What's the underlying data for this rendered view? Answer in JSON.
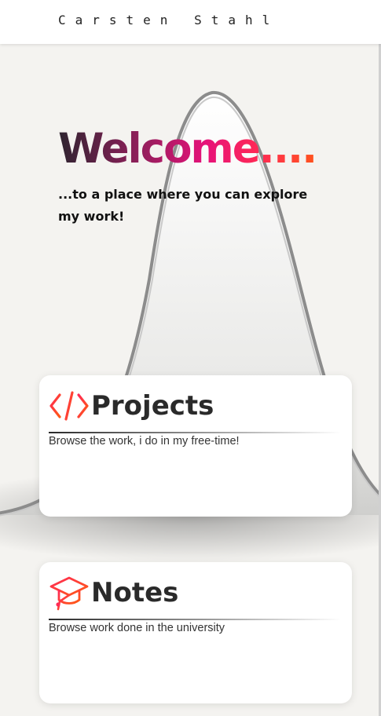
{
  "header": {
    "brand": "Carsten Stahl"
  },
  "hero": {
    "title": "Welcome....",
    "subtitle": "...to a place where you can explore my work!"
  },
  "cards": [
    {
      "title": "Projects",
      "description": "Browse the work, i do in my free-time!",
      "icon": "code-brackets-icon"
    },
    {
      "title": "Notes",
      "description": "Browse work done in the university",
      "icon": "graduation-cap-icon"
    }
  ],
  "colors": {
    "gradient": [
      "#2e2430",
      "#8e1f5a",
      "#e6127a",
      "#ff2a55",
      "#ff5a14"
    ],
    "background": "#f4f3f0",
    "card": "#ffffff"
  }
}
